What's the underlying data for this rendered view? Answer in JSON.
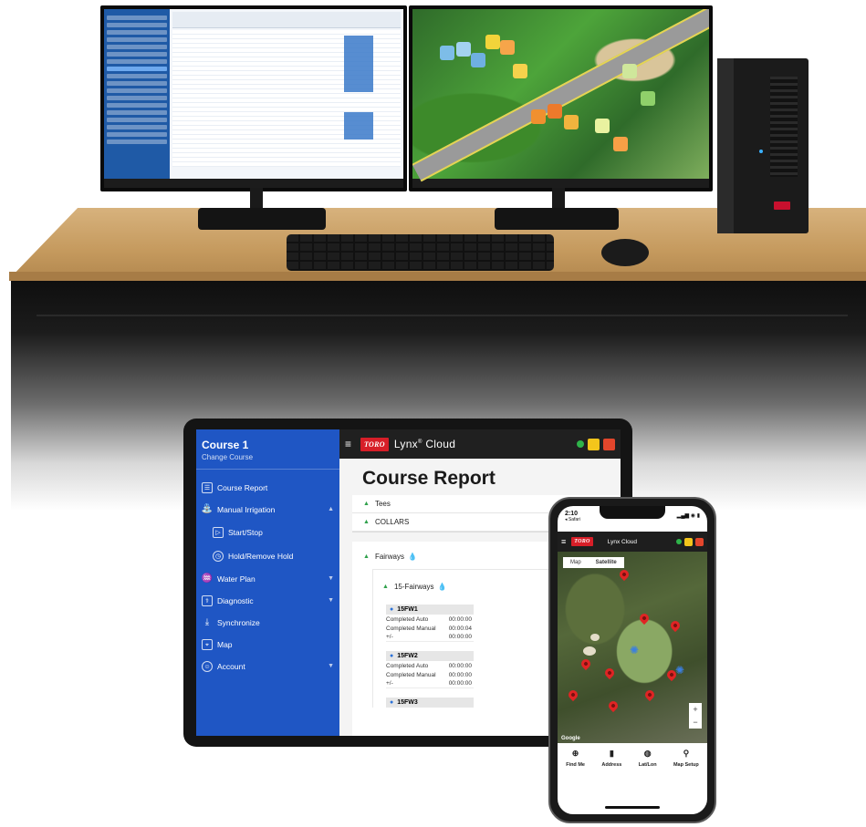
{
  "tablet": {
    "sidebar": {
      "course_title": "Course 1",
      "change_course": "Change Course",
      "items": [
        {
          "label": "Course Report"
        },
        {
          "label": "Manual Irrigation"
        },
        {
          "label": "Start/Stop"
        },
        {
          "label": "Hold/Remove Hold"
        },
        {
          "label": "Water Plan"
        },
        {
          "label": "Diagnostic"
        },
        {
          "label": "Synchronize"
        },
        {
          "label": "Map"
        },
        {
          "label": "Account"
        }
      ]
    },
    "topbar": {
      "brand_badge": "TORO",
      "app_name": "Lynx",
      "app_sup": "®",
      "app_suffix": "Cloud"
    },
    "report": {
      "title": "Course Report",
      "areas": [
        "Tees",
        "COLLARS",
        "Fairways"
      ],
      "sub_area": "15-Fairways",
      "stations": [
        {
          "name": "15FW1",
          "rows": [
            {
              "label": "Completed Auto",
              "value": "00:00:00"
            },
            {
              "label": "Completed Manual",
              "value": "00:00:04"
            },
            {
              "label": "+/-",
              "value": "00:00:00"
            }
          ]
        },
        {
          "name": "15FW2",
          "rows": [
            {
              "label": "Completed Auto",
              "value": "00:00:00"
            },
            {
              "label": "Completed Manual",
              "value": "00:00:00"
            },
            {
              "label": "+/-",
              "value": "00:00:00"
            }
          ]
        },
        {
          "name": "15FW3",
          "rows": []
        }
      ]
    }
  },
  "phone": {
    "status": {
      "time": "2:10",
      "carrier": "◂ Safari",
      "signals": "▂▄▆ ◉ ▮"
    },
    "topbar": {
      "brand_badge": "TORO",
      "app_name": "Lynx",
      "app_suffix": "Cloud"
    },
    "map_tabs": [
      "Map",
      "Satellite"
    ],
    "map_credit": "Google",
    "zoom": {
      "plus": "+",
      "minus": "−"
    },
    "bottom_buttons": [
      {
        "label": "Find Me",
        "icon": "crosshair-icon"
      },
      {
        "label": "Address",
        "icon": "book-icon"
      },
      {
        "label": "Lat/Lon",
        "icon": "globe-icon"
      },
      {
        "label": "Map Setup",
        "icon": "pin-icon"
      }
    ]
  },
  "colors": {
    "sidebar_blue": "#1f56c4",
    "toro_red": "#d71e28",
    "status_green": "#2fb44a",
    "status_yellow": "#f4c51b",
    "status_red": "#e3462c",
    "sprinkler_blue": "#3b7fe0"
  }
}
